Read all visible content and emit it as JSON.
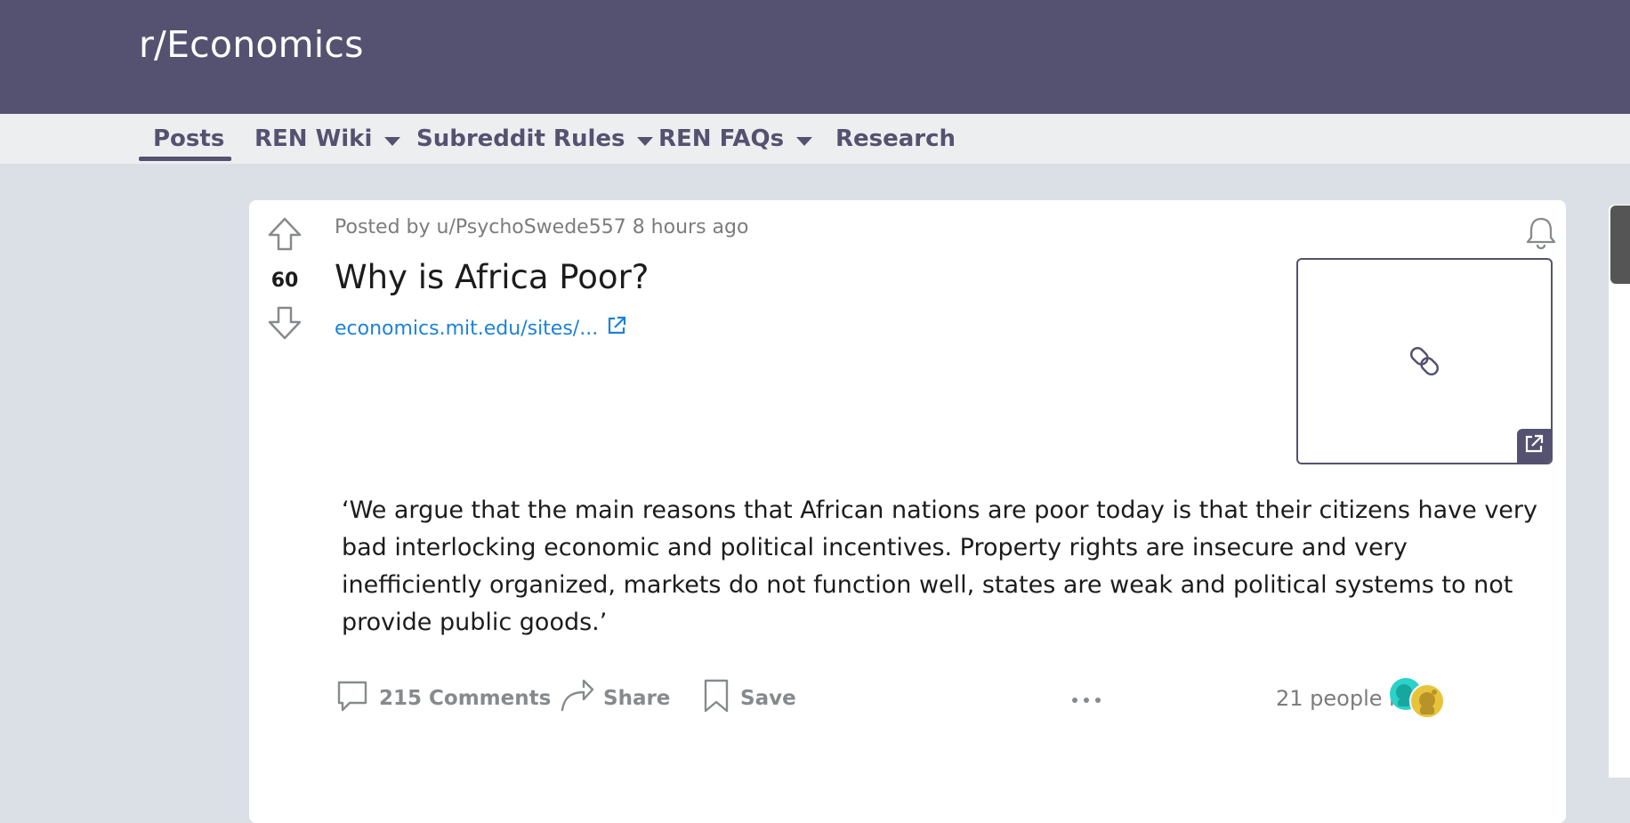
{
  "subreddit": {
    "name": "r/Economics"
  },
  "nav": {
    "items": [
      {
        "label": "Posts",
        "has_dropdown": false,
        "active": true
      },
      {
        "label": "REN Wiki",
        "has_dropdown": true
      },
      {
        "label": "Subreddit Rules",
        "has_dropdown": true
      },
      {
        "label": "REN FAQs",
        "has_dropdown": true
      },
      {
        "label": "Research",
        "has_dropdown": false
      }
    ]
  },
  "post": {
    "score": "60",
    "meta": "Posted by u/PsychoSwede557 8 hours ago",
    "title": "Why is Africa Poor?",
    "link_text": "economics.mit.edu/sites/...",
    "body": "‘We argue that the main reasons that African nations are poor today is that their citizens have very bad interlocking economic and political incentives. Property rights are insecure and very inefficiently organized, markets do not function well, states are weak and political systems to not provide public goods.’",
    "actions": {
      "comments_label": "215 Comments",
      "share_label": "Share",
      "save_label": "Save"
    },
    "online_text": "21 people here"
  },
  "colors": {
    "banner": "#545270",
    "nav_bg": "#edeef0",
    "page_bg": "#dae0e6",
    "link": "#1d82d6",
    "avatar_teal": "#2ad2c9",
    "avatar_gold": "#e7c43a"
  },
  "icons": {
    "upvote": "arrow-up-icon",
    "downvote": "arrow-down-icon",
    "bell": "bell-icon",
    "external": "external-link-icon",
    "chain": "chain-link-icon",
    "comment": "comment-bubble-icon",
    "share": "share-arrow-icon",
    "save": "bookmark-icon",
    "more": "more-dots-icon"
  }
}
